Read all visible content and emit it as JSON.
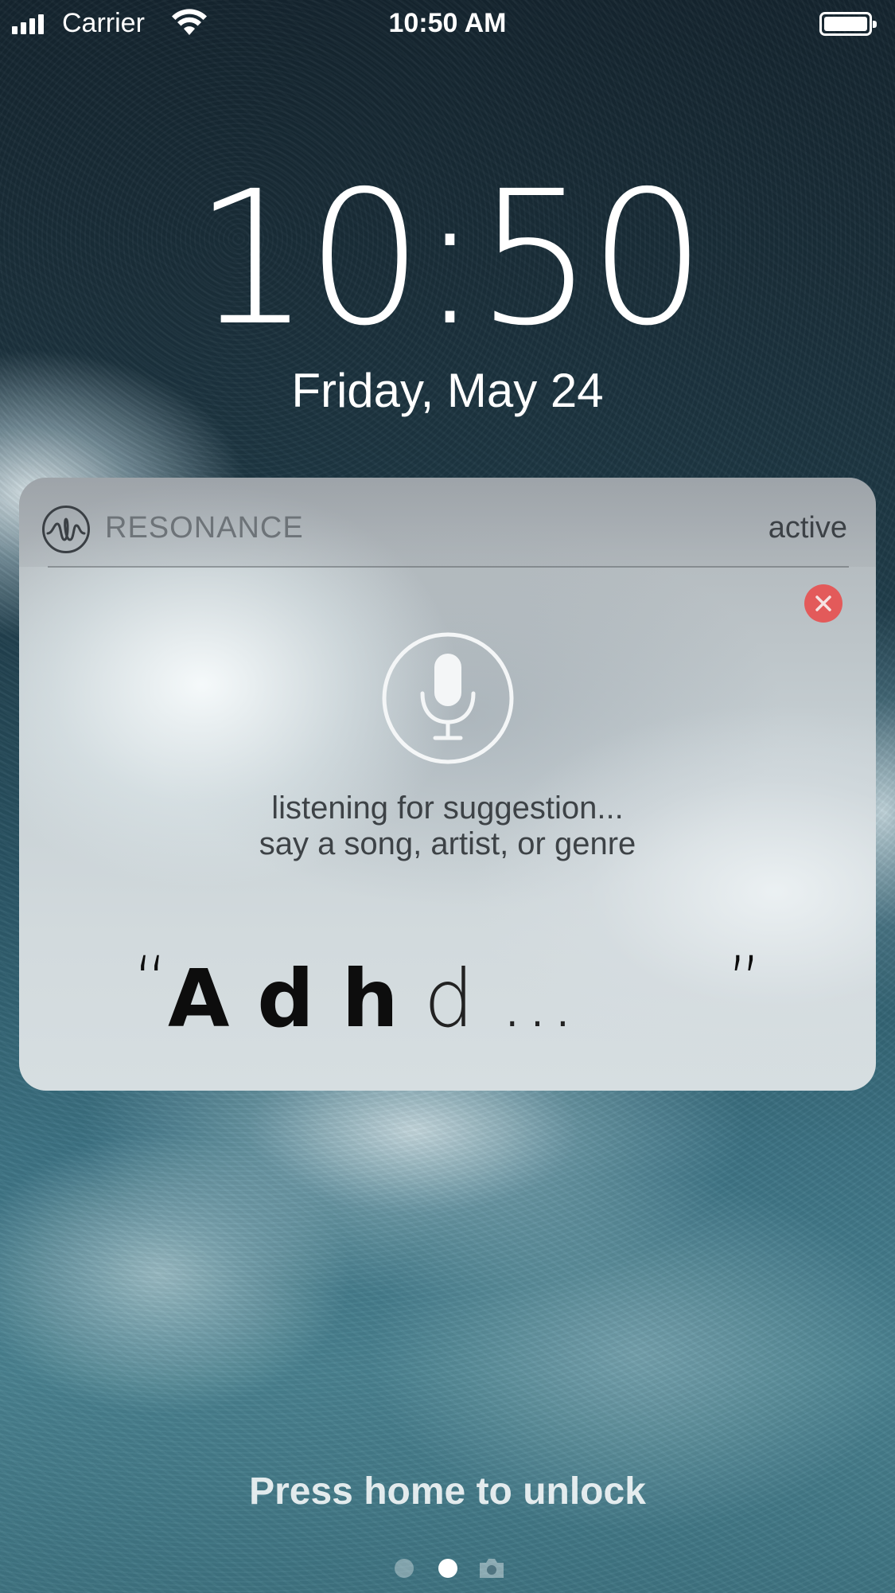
{
  "status_bar": {
    "carrier": "Carrier",
    "time": "10:50 AM",
    "signal_bars": 4,
    "battery_level": 1.0
  },
  "lock_screen": {
    "time": "10:50",
    "date": "Friday, May 24",
    "unlock_hint": "Press home to unlock",
    "page_count": 3,
    "active_page": 2
  },
  "notification": {
    "app_name": "RESONANCE",
    "status": "active",
    "app_icon": "resonance-wave-icon",
    "close_icon": "close-icon",
    "mic_icon": "microphone-icon",
    "prompt_line1": "listening for suggestion...",
    "prompt_line2": "say a song, artist, or genre",
    "transcript": {
      "open_quote": "“",
      "bold_text": "A d h",
      "partial_text": " d ...",
      "close_quote": "”"
    },
    "close_color": "#e35a5a"
  }
}
